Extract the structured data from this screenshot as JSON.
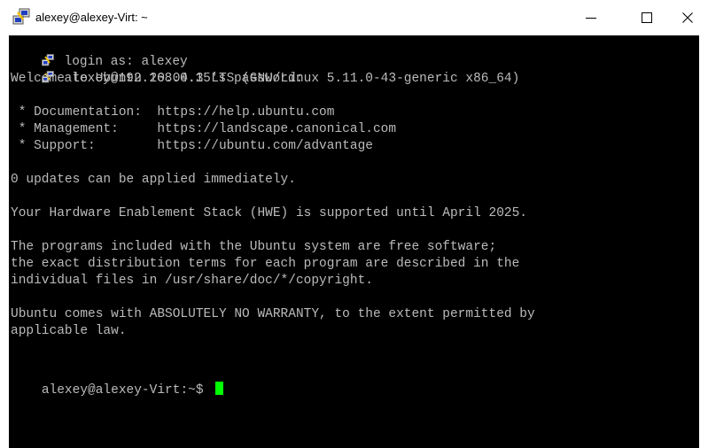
{
  "window": {
    "title": "alexey@alexey-Virt: ~",
    "icon": "putty-icon",
    "controls": [
      "minimize-icon",
      "maximize-icon",
      "close-icon"
    ]
  },
  "terminal": {
    "lines": [
      " login as: alexey",
      " alexey@192.168.0.15's password:",
      "Welcome to Ubuntu 20.04.3 LTS (GNU/Linux 5.11.0-43-generic x86_64)",
      "",
      " * Documentation:  https://help.ubuntu.com",
      " * Management:     https://landscape.canonical.com",
      " * Support:        https://ubuntu.com/advantage",
      "",
      "0 updates can be applied immediately.",
      "",
      "Your Hardware Enablement Stack (HWE) is supported until April 2025.",
      "",
      "The programs included with the Ubuntu system are free software;",
      "the exact distribution terms for each program are described in the",
      "individual files in /usr/share/doc/*/copyright.",
      "",
      "Ubuntu comes with ABSOLUTELY NO WARRANTY, to the extent permitted by",
      "applicable law.",
      "",
      "alexey@alexey-Virt:~$ "
    ],
    "text_color": "#bbbbbb",
    "background": "#000000",
    "cursor_color": "#00ff00"
  }
}
